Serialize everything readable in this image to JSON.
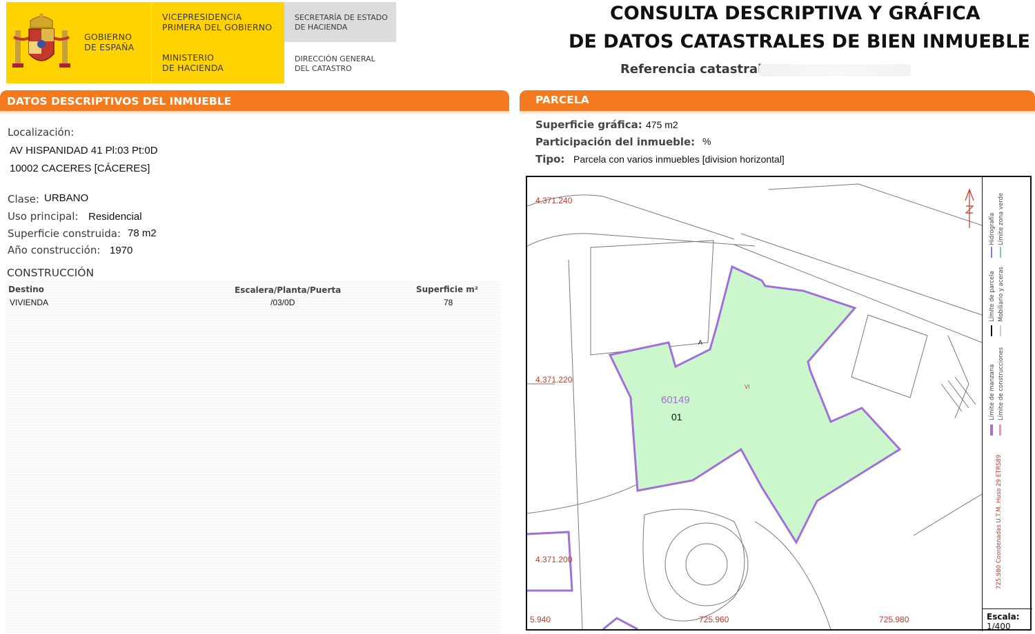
{
  "header": {
    "gob_line1": "GOBIERNO",
    "gob_line2": "DE ESPAÑA",
    "vice_line1": "VICEPRESIDENCIA",
    "vice_line2": "PRIMERA DEL GOBIERNO",
    "min_line1": "MINISTERIO",
    "min_line2": "DE HACIENDA",
    "sec_line1": "SECRETARÍA DE ESTADO",
    "sec_line2": "DE HACIENDA",
    "dir_line1": "DIRECCIÓN GENERAL",
    "dir_line2": "DEL CATASTRO",
    "brand_colors": {
      "yellow": "#ffd200",
      "orange": "#f47a20",
      "gray": "#dcdcdc"
    }
  },
  "title": {
    "line1": "CONSULTA DESCRIPTIVA Y GRÁFICA",
    "line2": "DE DATOS CATASTRALES DE BIEN INMUEBLE",
    "ref_label": "Referencia catastral:"
  },
  "left_panel": {
    "bar_title": "DATOS DESCRIPTIVOS DEL INMUEBLE",
    "localizacion_label": "Localización:",
    "address_line1": "AV HISPANIDAD 41 Pl:03 Pt:0D",
    "address_line2": "10002 CACERES [CÁCERES]",
    "clase_label": "Clase:",
    "clase_value": "URBANO",
    "uso_label": "Uso principal:",
    "uso_value": "Residencial",
    "sup_label": "Superficie construida:",
    "sup_value": "78 m2",
    "anio_label": "Año construcción:",
    "anio_value": "1970",
    "construccion_title": "CONSTRUCCIÓN",
    "table": {
      "headers": [
        "Destino",
        "Escalera/Planta/Puerta",
        "Superficie m²"
      ],
      "rows": [
        [
          "VIVIENDA",
          "/03/0D",
          "78"
        ]
      ]
    }
  },
  "right_panel": {
    "bar_title": "PARCELA",
    "sup_grafica_label": "Superficie gráfica:",
    "sup_grafica_value": "475 m2",
    "participacion_label": "Participación del inmueble:",
    "participacion_value": "%",
    "tipo_label": "Tipo:",
    "tipo_value": "Parcela con varios inmuebles [division horizontal]"
  },
  "map": {
    "coord_y1": "4.371.240",
    "coord_y2": "4.371.220",
    "coord_y3": "4.371.200",
    "coord_x0": "5.940",
    "coord_x1": "725.960",
    "coord_x2": "725.980",
    "parcel_number": "60149",
    "parcel_sub": "01",
    "label_a": "A",
    "label_vi": "VI",
    "utm_text": "725.980 Coordenadas U.T.M. Huso 29 ETRS89",
    "legend": {
      "manzana": "Límite de manzana",
      "construcciones": "Límite de construcciones",
      "parcela": "Límite de parcela",
      "mobiliario": "Mobiliario y aceras",
      "hidrografia": "Hidrografía",
      "zona_verde": "Límite zona verde"
    },
    "escala_label": "Escala:",
    "escala_value": "1/400",
    "colors": {
      "parcel_fill": "#ccf7cc",
      "parcel_border": "#a070d8",
      "coord_text": "#c0392b"
    }
  }
}
